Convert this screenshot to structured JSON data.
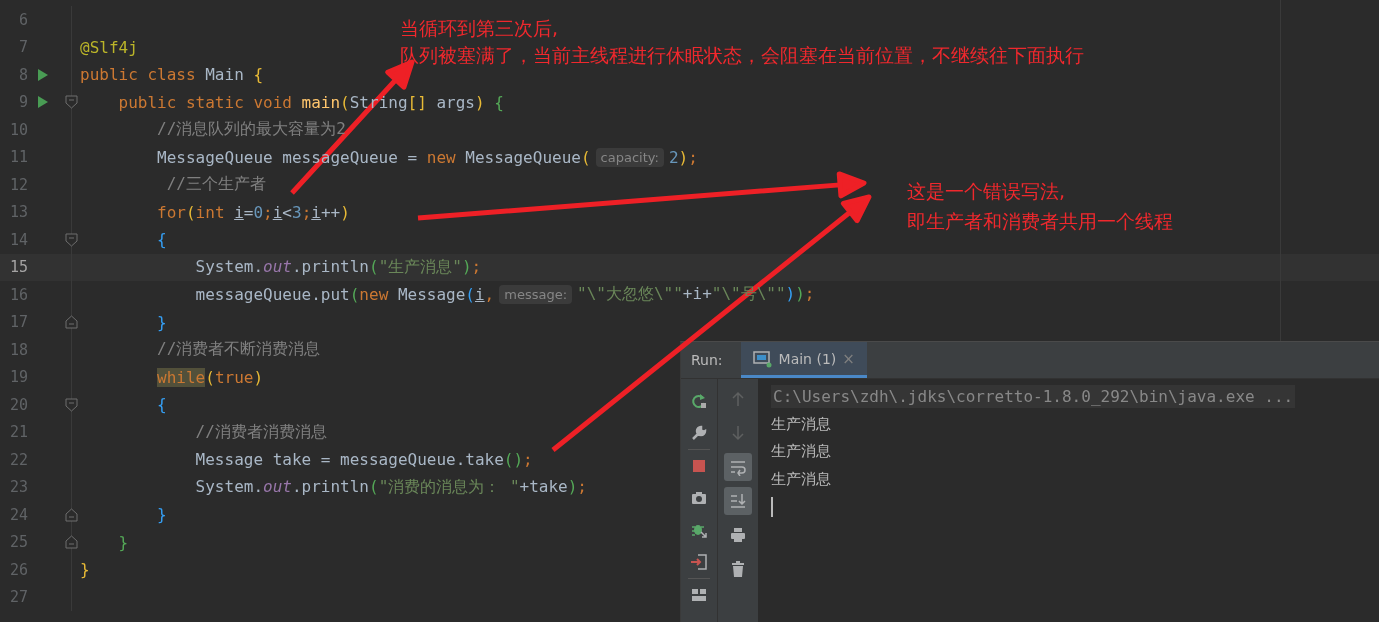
{
  "editor": {
    "lines": [
      {
        "number": "6",
        "current": false,
        "run_marker": false,
        "fold_start": false,
        "fold_end": false
      },
      {
        "number": "7",
        "current": false,
        "run_marker": false,
        "fold_start": false,
        "fold_end": false,
        "tokens": [
          {
            "kind": "ann",
            "text": "@Slf4j"
          }
        ]
      },
      {
        "number": "8",
        "current": false,
        "run_marker": true,
        "fold_start": false,
        "fold_end": false,
        "tokens": [
          {
            "kind": "kw",
            "text": "public class "
          },
          {
            "kind": "plain",
            "text": "Main "
          },
          {
            "kind": "paren_y",
            "text": "{"
          }
        ]
      },
      {
        "number": "9",
        "current": false,
        "run_marker": true,
        "fold_start": true,
        "fold_end": false,
        "tokens": [
          {
            "kind": "kw",
            "text": "    public static void "
          },
          {
            "kind": "fn",
            "text": "main"
          },
          {
            "kind": "paren_y",
            "text": "("
          },
          {
            "kind": "plain",
            "text": "String"
          },
          {
            "kind": "paren_y",
            "text": "[]"
          },
          {
            "kind": "plain",
            "text": " args"
          },
          {
            "kind": "paren_y",
            "text": ")"
          },
          {
            "kind": "paren_g",
            "text": " {"
          }
        ]
      },
      {
        "number": "10",
        "current": false,
        "run_marker": false,
        "fold_start": false,
        "fold_end": false,
        "tokens": [
          {
            "kind": "comment",
            "text": "        //消息队列的最大容量为2"
          }
        ]
      },
      {
        "number": "11",
        "current": false,
        "run_marker": false,
        "fold_start": false,
        "fold_end": false,
        "tokens": [
          {
            "kind": "plain",
            "text": "        MessageQueue messageQueue = "
          },
          {
            "kind": "kw",
            "text": "new "
          },
          {
            "kind": "plain",
            "text": "MessageQueue"
          },
          {
            "kind": "paren_y",
            "text": "("
          },
          {
            "kind": "hint",
            "text": "capacity:"
          },
          {
            "kind": "num",
            "text": "2"
          },
          {
            "kind": "paren_y",
            "text": ")"
          },
          {
            "kind": "kw",
            "text": ";"
          }
        ]
      },
      {
        "number": "12",
        "current": false,
        "run_marker": false,
        "fold_start": false,
        "fold_end": false,
        "tokens": [
          {
            "kind": "comment",
            "text": "         //三个生产者"
          }
        ]
      },
      {
        "number": "13",
        "current": false,
        "run_marker": false,
        "fold_start": false,
        "fold_end": false,
        "tokens": [
          {
            "kind": "kw",
            "text": "        for"
          },
          {
            "kind": "paren_y",
            "text": "("
          },
          {
            "kind": "kw",
            "text": "int "
          },
          {
            "kind": "var",
            "text": "i"
          },
          {
            "kind": "plain",
            "text": "="
          },
          {
            "kind": "num",
            "text": "0"
          },
          {
            "kind": "kw",
            "text": ";"
          },
          {
            "kind": "var",
            "text": "i"
          },
          {
            "kind": "plain",
            "text": "<"
          },
          {
            "kind": "num",
            "text": "3"
          },
          {
            "kind": "kw",
            "text": ";"
          },
          {
            "kind": "var",
            "text": "i"
          },
          {
            "kind": "plain",
            "text": "++"
          },
          {
            "kind": "paren_y",
            "text": ")"
          }
        ]
      },
      {
        "number": "14",
        "current": false,
        "run_marker": false,
        "fold_start": true,
        "fold_end": false,
        "tokens": [
          {
            "kind": "paren_b",
            "text": "        {"
          }
        ]
      },
      {
        "number": "15",
        "current": true,
        "run_marker": false,
        "fold_start": false,
        "fold_end": false,
        "tokens": [
          {
            "kind": "plain",
            "text": "            System."
          },
          {
            "kind": "static",
            "text": "out"
          },
          {
            "kind": "plain",
            "text": ".println"
          },
          {
            "kind": "paren_g",
            "text": "("
          },
          {
            "kind": "str",
            "text": "\"生产消息\""
          },
          {
            "kind": "paren_g",
            "text": ")"
          },
          {
            "kind": "kw",
            "text": ";"
          }
        ]
      },
      {
        "number": "16",
        "current": false,
        "run_marker": false,
        "fold_start": false,
        "fold_end": false,
        "tokens": [
          {
            "kind": "plain",
            "text": "            messageQueue.put"
          },
          {
            "kind": "paren_g",
            "text": "("
          },
          {
            "kind": "kw",
            "text": "new "
          },
          {
            "kind": "plain",
            "text": "Message"
          },
          {
            "kind": "paren_b",
            "text": "("
          },
          {
            "kind": "var",
            "text": "i"
          },
          {
            "kind": "kw",
            "text": ","
          },
          {
            "kind": "hint",
            "text": "message:"
          },
          {
            "kind": "str",
            "text": "\"\\\"大忽悠\\\"\""
          },
          {
            "kind": "plain",
            "text": "+i+"
          },
          {
            "kind": "str",
            "text": "\"\\\"号\\\"\""
          },
          {
            "kind": "paren_b",
            "text": ")"
          },
          {
            "kind": "paren_g",
            "text": ")"
          },
          {
            "kind": "kw",
            "text": ";"
          }
        ]
      },
      {
        "number": "17",
        "current": false,
        "run_marker": false,
        "fold_start": false,
        "fold_end": true,
        "tokens": [
          {
            "kind": "paren_b",
            "text": "        }"
          }
        ]
      },
      {
        "number": "18",
        "current": false,
        "run_marker": false,
        "fold_start": false,
        "fold_end": false,
        "tokens": [
          {
            "kind": "comment",
            "text": "        //消费者不断消费消息"
          }
        ]
      },
      {
        "number": "19",
        "current": false,
        "run_marker": false,
        "fold_start": false,
        "fold_end": false,
        "tokens": [
          {
            "kind": "marked",
            "text": "        while"
          },
          {
            "kind": "paren_y",
            "text": "("
          },
          {
            "kind": "kw",
            "text": "true"
          },
          {
            "kind": "paren_y",
            "text": ")"
          }
        ]
      },
      {
        "number": "20",
        "current": false,
        "run_marker": false,
        "fold_start": true,
        "fold_end": false,
        "tokens": [
          {
            "kind": "paren_b",
            "text": "        {"
          }
        ]
      },
      {
        "number": "21",
        "current": false,
        "run_marker": false,
        "fold_start": false,
        "fold_end": false,
        "tokens": [
          {
            "kind": "comment",
            "text": "            //消费者消费消息"
          }
        ]
      },
      {
        "number": "22",
        "current": false,
        "run_marker": false,
        "fold_start": false,
        "fold_end": false,
        "tokens": [
          {
            "kind": "plain",
            "text": "            Message take = messageQueue.take"
          },
          {
            "kind": "paren_g",
            "text": "()"
          },
          {
            "kind": "kw",
            "text": ";"
          }
        ]
      },
      {
        "number": "23",
        "current": false,
        "run_marker": false,
        "fold_start": false,
        "fold_end": false,
        "tokens": [
          {
            "kind": "plain",
            "text": "            System."
          },
          {
            "kind": "static",
            "text": "out"
          },
          {
            "kind": "plain",
            "text": ".println"
          },
          {
            "kind": "paren_g",
            "text": "("
          },
          {
            "kind": "str",
            "text": "\"消费的消息为： \""
          },
          {
            "kind": "plain",
            "text": "+take"
          },
          {
            "kind": "paren_g",
            "text": ")"
          },
          {
            "kind": "kw",
            "text": ";"
          }
        ]
      },
      {
        "number": "24",
        "current": false,
        "run_marker": false,
        "fold_start": false,
        "fold_end": true,
        "tokens": [
          {
            "kind": "paren_b",
            "text": "        }"
          }
        ]
      },
      {
        "number": "25",
        "current": false,
        "run_marker": false,
        "fold_start": false,
        "fold_end": true,
        "tokens": [
          {
            "kind": "paren_g",
            "text": "    }"
          }
        ]
      },
      {
        "number": "26",
        "current": false,
        "run_marker": false,
        "fold_start": false,
        "fold_end": false,
        "tokens": [
          {
            "kind": "paren_y",
            "text": "}"
          }
        ]
      },
      {
        "number": "27",
        "current": false,
        "run_marker": false,
        "fold_start": false,
        "fold_end": false
      }
    ]
  },
  "run_panel": {
    "label": "Run:",
    "tabs": [
      {
        "title": "Main (1)",
        "selected": true,
        "close": "×"
      }
    ],
    "secondary_toolbar": [
      {
        "disabled": true,
        "on": false
      },
      {
        "disabled": true,
        "on": false
      },
      {
        "disabled": false,
        "on": true
      },
      {
        "disabled": false,
        "on": true
      },
      {
        "disabled": false,
        "on": false
      },
      {
        "disabled": false,
        "on": false
      }
    ],
    "console": [
      {
        "kind": "command",
        "text": "C:\\Users\\zdh\\.jdks\\corretto-1.8.0_292\\bin\\java.exe ..."
      },
      {
        "kind": "output",
        "text": "生产消息"
      },
      {
        "kind": "output",
        "text": "生产消息"
      },
      {
        "kind": "output",
        "text": "生产消息"
      }
    ]
  },
  "annotations": [
    {
      "lines": [
        "当循环到第三次后,",
        "队列被塞满了，当前主线程进行休眠状态，会阻塞在当前位置，不继续往下面执行"
      ]
    },
    {
      "lines": [
        "这是一个错误写法,",
        "即生产者和消费者共用一个线程"
      ]
    }
  ]
}
